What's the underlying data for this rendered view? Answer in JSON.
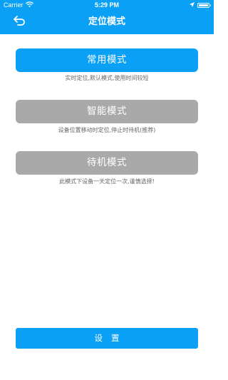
{
  "status_bar": {
    "carrier": "Carrier",
    "time": "5:29 PM",
    "icons": [
      "wifi-icon",
      "location-arrow-icon",
      "battery-icon"
    ],
    "battery_level": 1.0
  },
  "nav": {
    "title": "定位模式",
    "back_icon": "back-arrow-icon"
  },
  "modes": [
    {
      "label": "常用模式",
      "description": "实时定位,默认模式,使用时间较短",
      "selected": true
    },
    {
      "label": "智能模式",
      "description": "设备位置移动时定位,停止时待机(推荐)",
      "selected": false
    },
    {
      "label": "待机模式",
      "description": "此模式下设备一天定位一次,谨慎选择!",
      "selected": false
    }
  ],
  "settings_button": {
    "label": "设置"
  },
  "colors": {
    "accent": "#0aa0f5",
    "inactive": "#a9a9a9",
    "description_text": "#666666",
    "background": "#ffffff"
  }
}
